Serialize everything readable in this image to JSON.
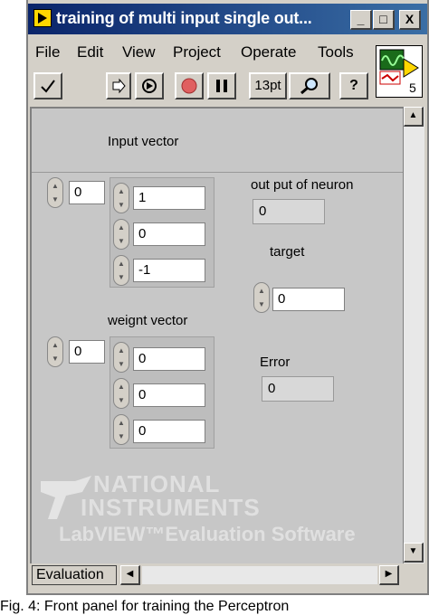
{
  "window": {
    "title": "training of multi input single out...",
    "minimize": "_",
    "maximize": "□",
    "close": "X"
  },
  "menu": [
    "File",
    "Edit",
    "View",
    "Project",
    "Operate",
    "Tools"
  ],
  "toolbar": {
    "font_size": "13pt",
    "help": "?"
  },
  "vi_icon": {
    "number": "5"
  },
  "panel": {
    "input_vector_label": "Input vector",
    "input_index": "0",
    "input_values": [
      "1",
      "0",
      "-1"
    ],
    "weight_vector_label": "weignt vector",
    "weight_index": "0",
    "weight_values": [
      "0",
      "0",
      "0"
    ],
    "output_label": "out put of neuron",
    "output_value": "0",
    "target_label": "target",
    "target_value": "0",
    "error_label": "Error",
    "error_value": "0"
  },
  "watermark": {
    "line1": "NATIONAL",
    "line2": "INSTRUMENTS",
    "line3": "LabVIEW™Evaluation Software"
  },
  "status": {
    "tab": "Evaluation"
  },
  "caption": "Fig. 4: Front panel for training the Perceptron"
}
